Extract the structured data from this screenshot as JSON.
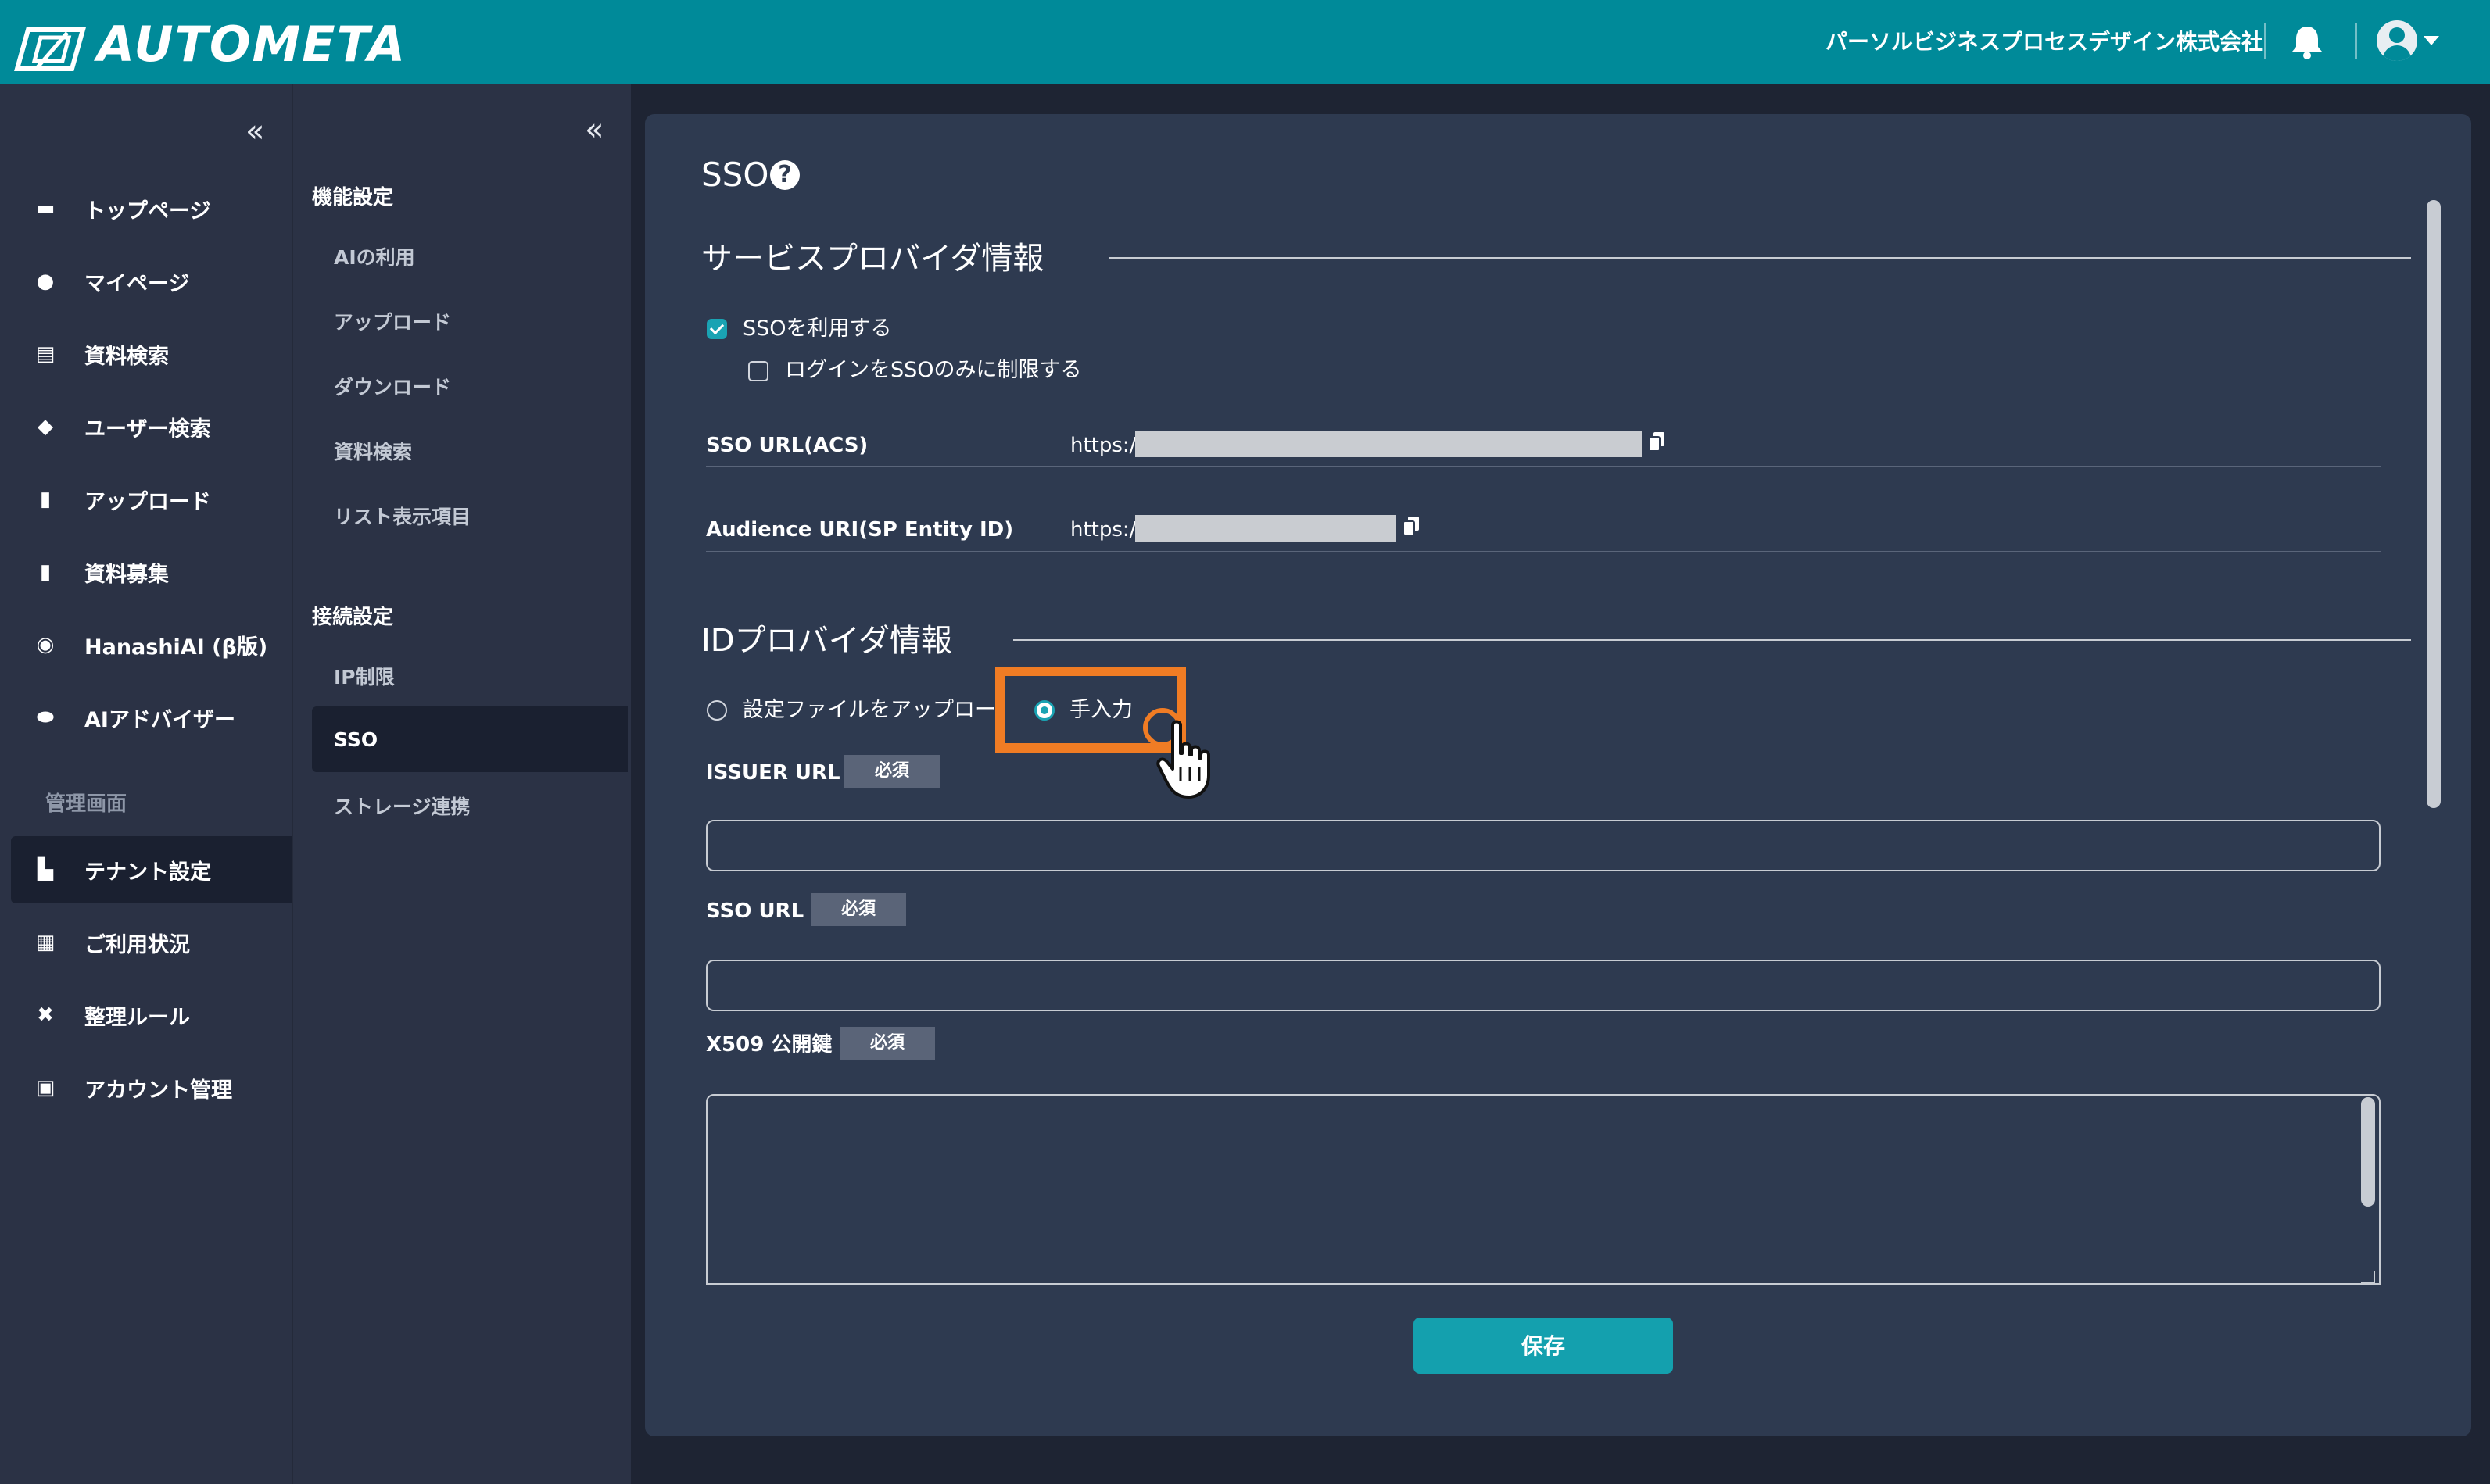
{
  "header": {
    "logo_text": "AUTOMETA",
    "company": "パーソルビジネスプロセスデザイン株式会社",
    "bell_icon": "bell-icon",
    "avatar_icon": "user-avatar-icon"
  },
  "sidebar": {
    "collapse_icon": "«",
    "items": [
      {
        "label": "トップページ",
        "icon": "store-icon"
      },
      {
        "label": "マイページ",
        "icon": "person-icon"
      },
      {
        "label": "資料検索",
        "icon": "document-search-icon"
      },
      {
        "label": "ユーザー検索",
        "icon": "user-search-icon"
      },
      {
        "label": "アップロード",
        "icon": "upload-file-icon"
      },
      {
        "label": "資料募集",
        "icon": "file-icon"
      },
      {
        "label": "HanashiAI (β版)",
        "icon": "chat-ai-icon"
      },
      {
        "label": "AIアドバイザー",
        "icon": "advisor-icon"
      }
    ],
    "admin_section": "管理画面",
    "admin_items": [
      {
        "label": "テナント設定",
        "icon": "tenant-icon"
      },
      {
        "label": "ご利用状況",
        "icon": "building-icon"
      },
      {
        "label": "整理ルール",
        "icon": "tools-icon"
      },
      {
        "label": "アカウント管理",
        "icon": "id-card-icon"
      }
    ]
  },
  "subnav": {
    "collapse_icon": "«",
    "group1": "機能設定",
    "group1_items": [
      "AIの利用",
      "アップロード",
      "ダウンロード",
      "資料検索",
      "リスト表示項目"
    ],
    "group2": "接続設定",
    "group2_items": [
      "IP制限",
      "SSO",
      "ストレージ連携"
    ]
  },
  "main": {
    "title": "SSO",
    "help": "?",
    "sp_section": "サービスプロバイダ情報",
    "use_sso": "SSOを利用する",
    "restrict_login": "ログインをSSOのみに制限する",
    "sso_url_acs_label": "SSO URL(ACS)",
    "sso_url_acs_value": "https://",
    "audience_label": "Audience URI(SP Entity ID)",
    "audience_value": "https://",
    "idp_section": "IDプロバイダ情報",
    "radio_upload": "設定ファイルをアップロー",
    "radio_manual": "手入力",
    "issuer_label": "ISSUER URL",
    "sso_url_label": "SSO URL",
    "x509_label": "X509 公開鍵",
    "required": "必須",
    "save": "保存"
  },
  "colors": {
    "header": "#008a99",
    "sidebar": "#2b3245",
    "panel": "#2e3a50",
    "accent": "#14a0ae",
    "highlight": "#f07c24"
  }
}
